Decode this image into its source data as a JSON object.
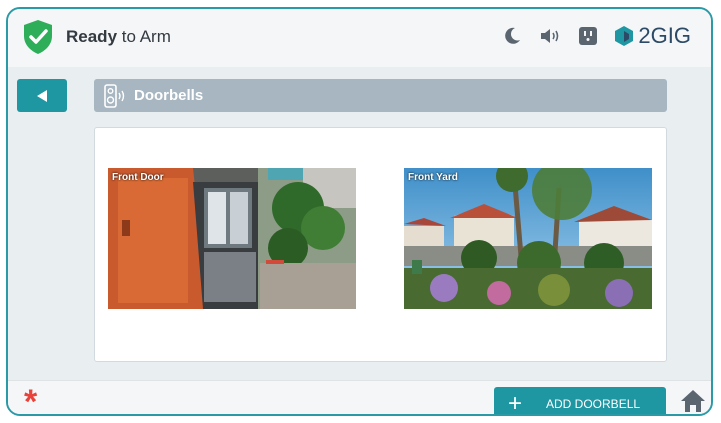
{
  "header": {
    "status_bold": "Ready",
    "status_rest": " to Arm",
    "brand": "2GIG",
    "icons": [
      "shield-check-icon",
      "moon-icon",
      "speaker-icon",
      "outlet-icon",
      "brand-logo-icon"
    ]
  },
  "page": {
    "title": "Doorbells",
    "back_icon": "back-arrow-icon"
  },
  "doorbells": [
    {
      "label": "Front Door"
    },
    {
      "label": "Front Yard"
    }
  ],
  "footer": {
    "add_button": "ADD DOORBELL",
    "add_icon": "plus-icon",
    "emergency_icon": "asterisk-icon",
    "home_icon": "home-icon"
  },
  "colors": {
    "accent": "#1e97a3",
    "status_green": "#2fae5a",
    "emergency": "#e8423a",
    "title_bar": "#a7b6c0"
  }
}
